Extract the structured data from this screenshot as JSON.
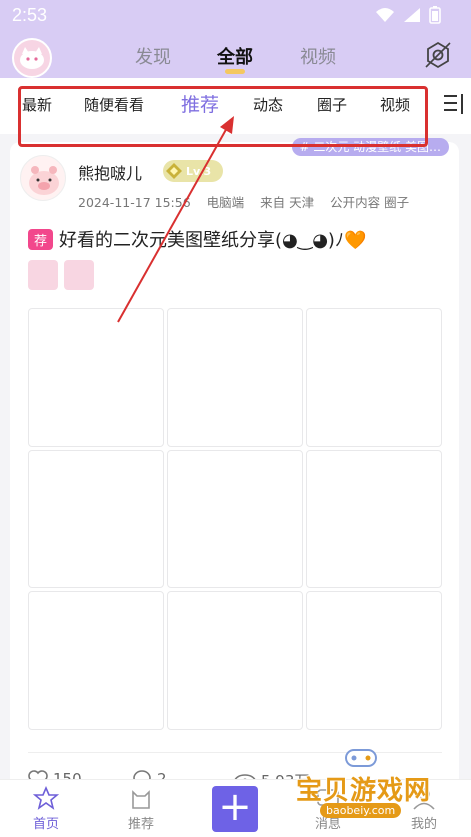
{
  "status_bar": {
    "time": "2:53"
  },
  "top_tabs": [
    "发现",
    "全部",
    "视频"
  ],
  "category_tabs": [
    "最新",
    "随便看看",
    "推荐",
    "动态",
    "圈子",
    "视频"
  ],
  "post": {
    "topic_tag": "# 二次元 动漫壁纸 美图…",
    "username": "熊抱啵儿",
    "level": "Lv.3",
    "date": "2024-11-17 15:56",
    "device": "电脑端",
    "location": "来自 天津",
    "visibility": "公开内容 圈子",
    "badge": "荐",
    "title": "好看的二次元美图壁纸分享(◕‿◕)ﾉ🧡",
    "likes": "150",
    "comments": "2",
    "views": "5.93万"
  },
  "bottom_nav": {
    "home": "首页",
    "recommend": "推荐",
    "messages": "消息",
    "mine": "我的"
  },
  "watermark": {
    "title": "宝贝游戏网",
    "url": "baobeiy.com"
  },
  "colors": {
    "accent": "#6e62e6",
    "header_bg": "#d8ccf4",
    "highlight_box": "#d93030",
    "badge": "#f2478c"
  }
}
